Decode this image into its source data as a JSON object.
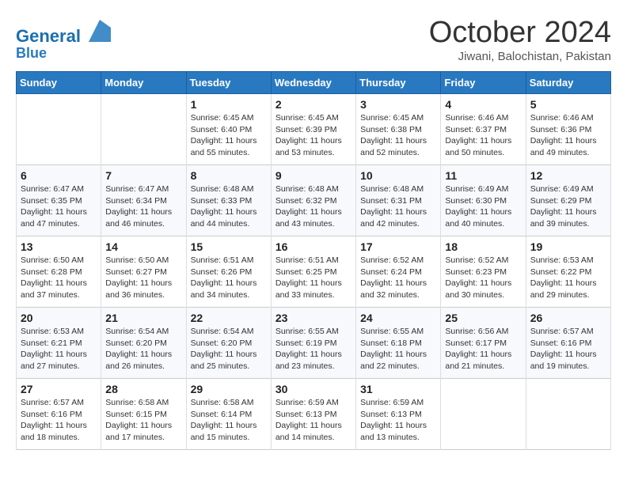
{
  "header": {
    "logo_line1": "General",
    "logo_line2": "Blue",
    "month": "October 2024",
    "location": "Jiwani, Balochistan, Pakistan"
  },
  "days_of_week": [
    "Sunday",
    "Monday",
    "Tuesday",
    "Wednesday",
    "Thursday",
    "Friday",
    "Saturday"
  ],
  "weeks": [
    [
      {
        "day": "",
        "info": ""
      },
      {
        "day": "",
        "info": ""
      },
      {
        "day": "1",
        "info": "Sunrise: 6:45 AM\nSunset: 6:40 PM\nDaylight: 11 hours and 55 minutes."
      },
      {
        "day": "2",
        "info": "Sunrise: 6:45 AM\nSunset: 6:39 PM\nDaylight: 11 hours and 53 minutes."
      },
      {
        "day": "3",
        "info": "Sunrise: 6:45 AM\nSunset: 6:38 PM\nDaylight: 11 hours and 52 minutes."
      },
      {
        "day": "4",
        "info": "Sunrise: 6:46 AM\nSunset: 6:37 PM\nDaylight: 11 hours and 50 minutes."
      },
      {
        "day": "5",
        "info": "Sunrise: 6:46 AM\nSunset: 6:36 PM\nDaylight: 11 hours and 49 minutes."
      }
    ],
    [
      {
        "day": "6",
        "info": "Sunrise: 6:47 AM\nSunset: 6:35 PM\nDaylight: 11 hours and 47 minutes."
      },
      {
        "day": "7",
        "info": "Sunrise: 6:47 AM\nSunset: 6:34 PM\nDaylight: 11 hours and 46 minutes."
      },
      {
        "day": "8",
        "info": "Sunrise: 6:48 AM\nSunset: 6:33 PM\nDaylight: 11 hours and 44 minutes."
      },
      {
        "day": "9",
        "info": "Sunrise: 6:48 AM\nSunset: 6:32 PM\nDaylight: 11 hours and 43 minutes."
      },
      {
        "day": "10",
        "info": "Sunrise: 6:48 AM\nSunset: 6:31 PM\nDaylight: 11 hours and 42 minutes."
      },
      {
        "day": "11",
        "info": "Sunrise: 6:49 AM\nSunset: 6:30 PM\nDaylight: 11 hours and 40 minutes."
      },
      {
        "day": "12",
        "info": "Sunrise: 6:49 AM\nSunset: 6:29 PM\nDaylight: 11 hours and 39 minutes."
      }
    ],
    [
      {
        "day": "13",
        "info": "Sunrise: 6:50 AM\nSunset: 6:28 PM\nDaylight: 11 hours and 37 minutes."
      },
      {
        "day": "14",
        "info": "Sunrise: 6:50 AM\nSunset: 6:27 PM\nDaylight: 11 hours and 36 minutes."
      },
      {
        "day": "15",
        "info": "Sunrise: 6:51 AM\nSunset: 6:26 PM\nDaylight: 11 hours and 34 minutes."
      },
      {
        "day": "16",
        "info": "Sunrise: 6:51 AM\nSunset: 6:25 PM\nDaylight: 11 hours and 33 minutes."
      },
      {
        "day": "17",
        "info": "Sunrise: 6:52 AM\nSunset: 6:24 PM\nDaylight: 11 hours and 32 minutes."
      },
      {
        "day": "18",
        "info": "Sunrise: 6:52 AM\nSunset: 6:23 PM\nDaylight: 11 hours and 30 minutes."
      },
      {
        "day": "19",
        "info": "Sunrise: 6:53 AM\nSunset: 6:22 PM\nDaylight: 11 hours and 29 minutes."
      }
    ],
    [
      {
        "day": "20",
        "info": "Sunrise: 6:53 AM\nSunset: 6:21 PM\nDaylight: 11 hours and 27 minutes."
      },
      {
        "day": "21",
        "info": "Sunrise: 6:54 AM\nSunset: 6:20 PM\nDaylight: 11 hours and 26 minutes."
      },
      {
        "day": "22",
        "info": "Sunrise: 6:54 AM\nSunset: 6:20 PM\nDaylight: 11 hours and 25 minutes."
      },
      {
        "day": "23",
        "info": "Sunrise: 6:55 AM\nSunset: 6:19 PM\nDaylight: 11 hours and 23 minutes."
      },
      {
        "day": "24",
        "info": "Sunrise: 6:55 AM\nSunset: 6:18 PM\nDaylight: 11 hours and 22 minutes."
      },
      {
        "day": "25",
        "info": "Sunrise: 6:56 AM\nSunset: 6:17 PM\nDaylight: 11 hours and 21 minutes."
      },
      {
        "day": "26",
        "info": "Sunrise: 6:57 AM\nSunset: 6:16 PM\nDaylight: 11 hours and 19 minutes."
      }
    ],
    [
      {
        "day": "27",
        "info": "Sunrise: 6:57 AM\nSunset: 6:16 PM\nDaylight: 11 hours and 18 minutes."
      },
      {
        "day": "28",
        "info": "Sunrise: 6:58 AM\nSunset: 6:15 PM\nDaylight: 11 hours and 17 minutes."
      },
      {
        "day": "29",
        "info": "Sunrise: 6:58 AM\nSunset: 6:14 PM\nDaylight: 11 hours and 15 minutes."
      },
      {
        "day": "30",
        "info": "Sunrise: 6:59 AM\nSunset: 6:13 PM\nDaylight: 11 hours and 14 minutes."
      },
      {
        "day": "31",
        "info": "Sunrise: 6:59 AM\nSunset: 6:13 PM\nDaylight: 11 hours and 13 minutes."
      },
      {
        "day": "",
        "info": ""
      },
      {
        "day": "",
        "info": ""
      }
    ]
  ]
}
